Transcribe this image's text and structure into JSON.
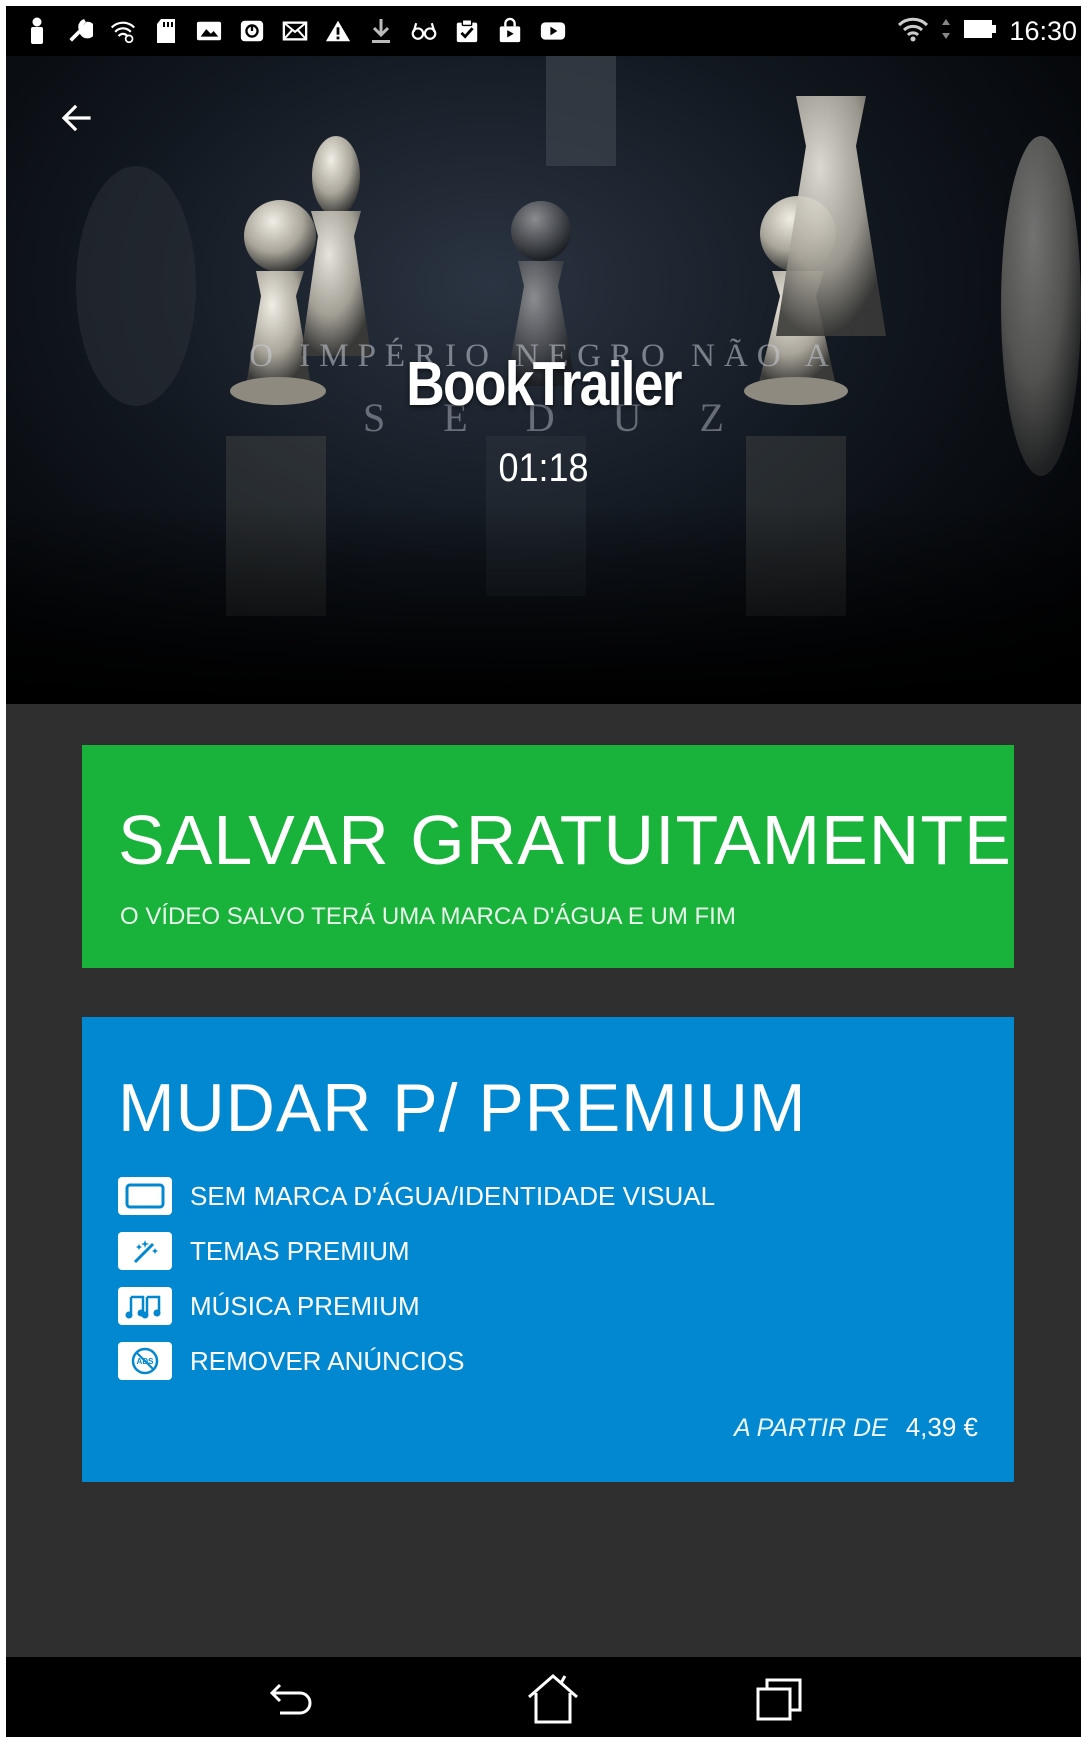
{
  "status_bar": {
    "time": "16:30",
    "notification_icons": [
      "person-icon",
      "wrench-icon",
      "wifi-hotspot-icon",
      "sd-card-icon",
      "image-icon",
      "sync-icon",
      "mail-icon",
      "warning-icon",
      "download-icon",
      "glasses-icon",
      "clipboard-check-icon",
      "shopping-bag-icon",
      "youtube-icon"
    ],
    "system_icons": [
      "wifi-icon",
      "signal-arrows-icon",
      "battery-icon"
    ]
  },
  "hero": {
    "background_caption_line1": "O IMPÉRIO NEGRO NÃO A",
    "background_caption_line2": "SEDUZ",
    "title": "BookTrailer",
    "duration": "01:18"
  },
  "save_free": {
    "title": "SALVAR GRATUITAMENTE",
    "subtitle": "O VÍDEO SALVO TERÁ UMA MARCA D'ÁGUA E UM FIM",
    "color": "#19b23b"
  },
  "premium": {
    "title": "MUDAR P/ PREMIUM",
    "color": "#0288d1",
    "features": [
      {
        "icon": "watermark-frame-icon",
        "label": "SEM MARCA D'ÁGUA/IDENTIDADE VISUAL"
      },
      {
        "icon": "magic-wand-icon",
        "label": "TEMAS PREMIUM"
      },
      {
        "icon": "music-notes-icon",
        "label": "MÚSICA PREMIUM"
      },
      {
        "icon": "no-ads-icon",
        "label": "REMOVER ANÚNCIOS"
      }
    ],
    "price_prefix": "A PARTIR DE",
    "price": "4,39 €"
  },
  "nav_bar": {
    "buttons": [
      "back-nav-icon",
      "home-nav-icon",
      "recent-apps-icon"
    ]
  }
}
